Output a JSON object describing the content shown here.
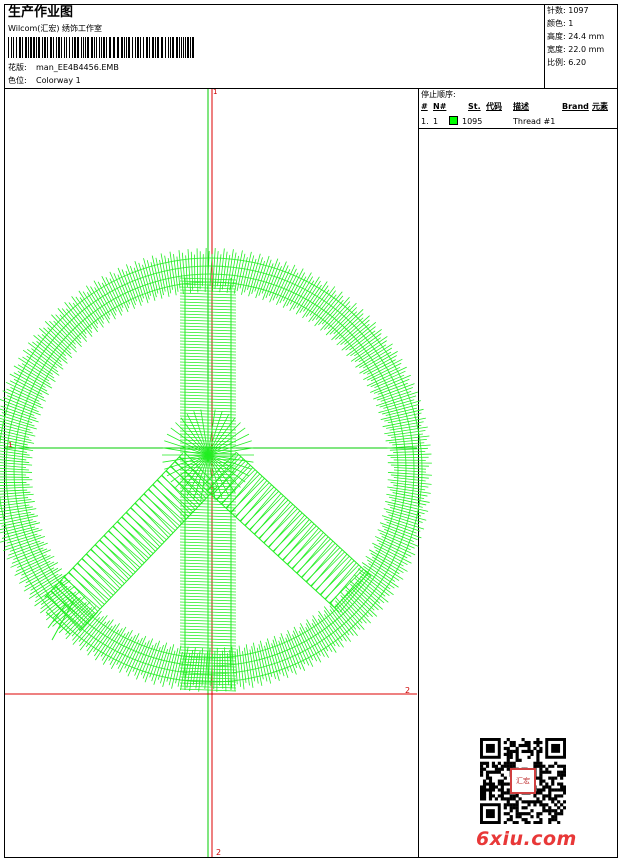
{
  "header": {
    "title": "生产作业图",
    "subtitle": "Wilcom(汇宏) 绣饰工作室",
    "design_label": "花版:",
    "design_value": "man_EE4B4456.EMB",
    "colorway_label": "色位:",
    "colorway_value": "Colorway 1"
  },
  "stats": [
    {
      "label": "针数:",
      "value": "1097"
    },
    {
      "label": "颜色:",
      "value": "1"
    },
    {
      "label": "高度:",
      "value": "24.4 mm"
    },
    {
      "label": "宽度:",
      "value": "22.0 mm"
    },
    {
      "label": "比例:",
      "value": "6.20"
    }
  ],
  "stop_sequence": {
    "title": "停止顺序:",
    "columns": [
      "#",
      "N#",
      "St.",
      "代码",
      "描述",
      "Brand",
      "元素"
    ],
    "rows": [
      {
        "index": "1.",
        "needle": "1",
        "swatch_color": "#00ff00",
        "code": "1095",
        "description": "Thread #1"
      }
    ]
  },
  "canvas": {
    "marker_top": "1",
    "marker_left": "1",
    "marker_right": "2",
    "marker_bottom": "2",
    "stitch_color": "#22ee22",
    "guide_color_green": "#00cc00",
    "guide_color_red": "#dd0000"
  },
  "watermark": {
    "text": "6xiu.com",
    "qr_stamp_text": "汇宏"
  }
}
